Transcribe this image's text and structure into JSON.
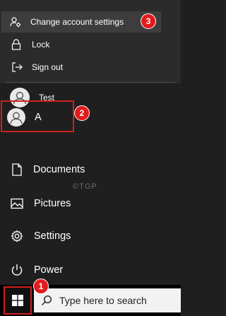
{
  "account_menu": {
    "change_settings": "Change account settings",
    "lock": "Lock",
    "sign_out": "Sign out",
    "other_user": "Test"
  },
  "start_rail": {
    "current_user": "A",
    "documents": "Documents",
    "pictures": "Pictures",
    "settings": "Settings",
    "power": "Power"
  },
  "watermark": "©TGP",
  "annotations": {
    "step1": "1",
    "step2": "2",
    "step3": "3"
  },
  "taskbar": {
    "search_placeholder": "Type here to search"
  },
  "icons": [
    "person-settings-icon",
    "lock-icon",
    "sign-out-icon",
    "avatar-icon",
    "document-icon",
    "pictures-icon",
    "settings-gear-icon",
    "power-icon",
    "windows-logo-icon",
    "search-icon"
  ],
  "colors": {
    "menu_bg": "#1f1f1f",
    "flyout_bg": "#2b2b2b",
    "highlight": "#3d3d3d",
    "annotation_red": "#e41b1b",
    "taskbar_bg": "#000000",
    "search_bg": "#f2f2f2"
  }
}
